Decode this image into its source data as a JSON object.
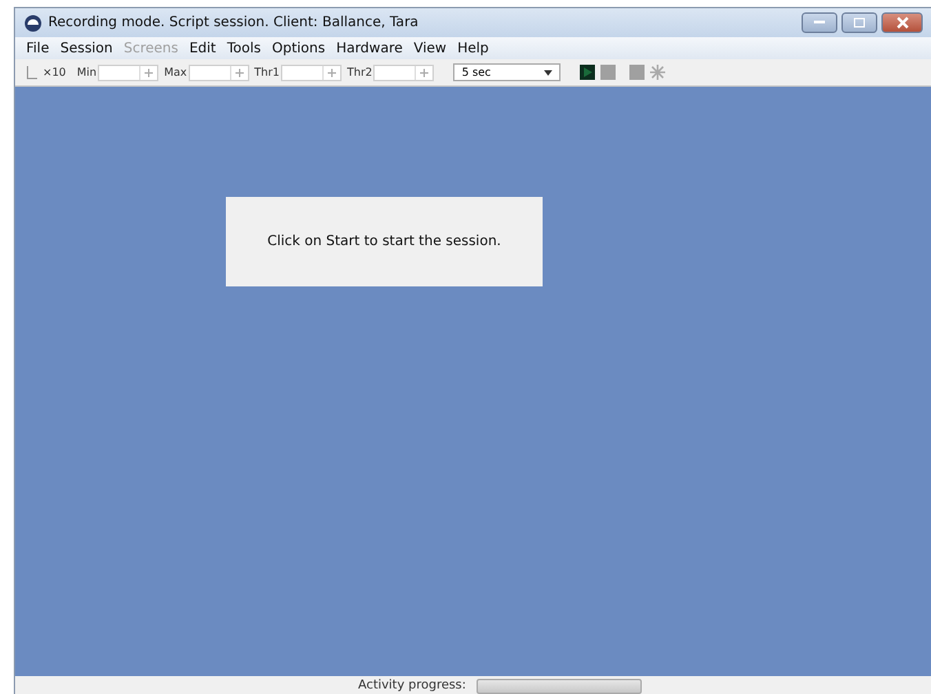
{
  "window": {
    "title": "Recording mode. Script session. Client: Ballance, Tara"
  },
  "menu": [
    {
      "label": "File",
      "disabled": false
    },
    {
      "label": "Session",
      "disabled": false
    },
    {
      "label": "Screens",
      "disabled": true
    },
    {
      "label": "Edit",
      "disabled": false
    },
    {
      "label": "Tools",
      "disabled": false
    },
    {
      "label": "Options",
      "disabled": false
    },
    {
      "label": "Hardware",
      "disabled": false
    },
    {
      "label": "View",
      "disabled": false
    },
    {
      "label": "Help",
      "disabled": false
    }
  ],
  "toolbar": {
    "scale": "×10",
    "fields": [
      {
        "label": "Min"
      },
      {
        "label": "Max"
      },
      {
        "label": "Thr1"
      },
      {
        "label": "Thr2"
      }
    ],
    "interval": "5 sec"
  },
  "message": "Click on Start to start the session.",
  "status_bar": {
    "label": "Activity progress:",
    "level": 0
  }
}
